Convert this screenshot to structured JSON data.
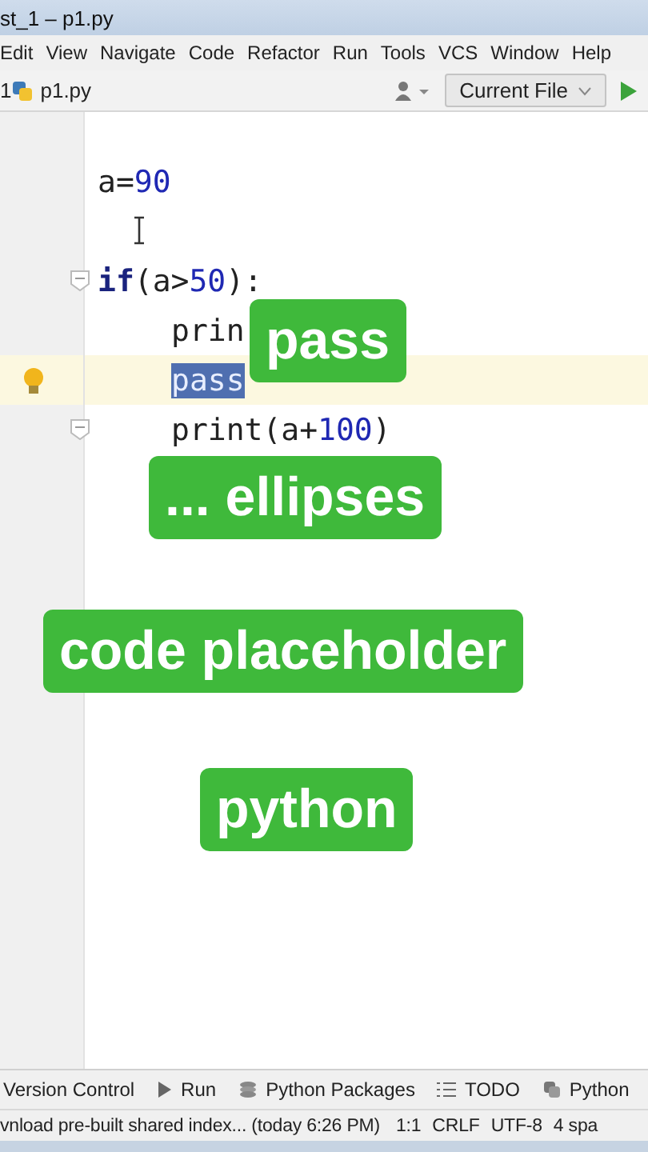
{
  "window": {
    "title": "st_1 – p1.py"
  },
  "menu": [
    "Edit",
    "View",
    "Navigate",
    "Code",
    "Refactor",
    "Run",
    "Tools",
    "VCS",
    "Window",
    "Help"
  ],
  "navbar": {
    "breadcrumbs": [
      "1",
      "p1.py"
    ],
    "run_config": "Current File"
  },
  "editor": {
    "lines": [
      {
        "current": false,
        "tokens": [
          {
            "kind": "plain",
            "text": "a="
          },
          {
            "kind": "number",
            "text": "90"
          }
        ]
      },
      {
        "current": false
      },
      {
        "current": false,
        "fold": true,
        "tokens": [
          {
            "kind": "keyword",
            "text": "if"
          },
          {
            "kind": "plain",
            "text": "(a>"
          },
          {
            "kind": "number",
            "text": "50"
          },
          {
            "kind": "plain",
            "text": "):"
          }
        ]
      },
      {
        "current": false,
        "indent": true,
        "tokens": [
          {
            "kind": "plain",
            "text": "prin"
          }
        ]
      },
      {
        "current": true,
        "indent": true,
        "tokens": [
          {
            "kind": "selection",
            "text": "pass"
          }
        ]
      },
      {
        "current": false,
        "fold": true,
        "indent": true,
        "tokens": [
          {
            "kind": "plain",
            "text": "print(a+"
          },
          {
            "kind": "number",
            "text": "100"
          },
          {
            "kind": "plain",
            "text": ")"
          }
        ]
      }
    ]
  },
  "captions": [
    "pass",
    "... ellipses",
    "code placeholder",
    "python"
  ],
  "tool_windows": [
    {
      "kind": "plain",
      "label": "Version Control"
    },
    {
      "kind": "run",
      "label": "Run"
    },
    {
      "kind": "packages",
      "label": "Python Packages"
    },
    {
      "kind": "todo",
      "label": "TODO"
    },
    {
      "kind": "python",
      "label": "Python"
    }
  ],
  "status_bar": {
    "message": "vnload pre-built shared index... (today 6:26 PM)",
    "items": [
      "1:1",
      "CRLF",
      "UTF-8",
      "4 spa"
    ]
  }
}
